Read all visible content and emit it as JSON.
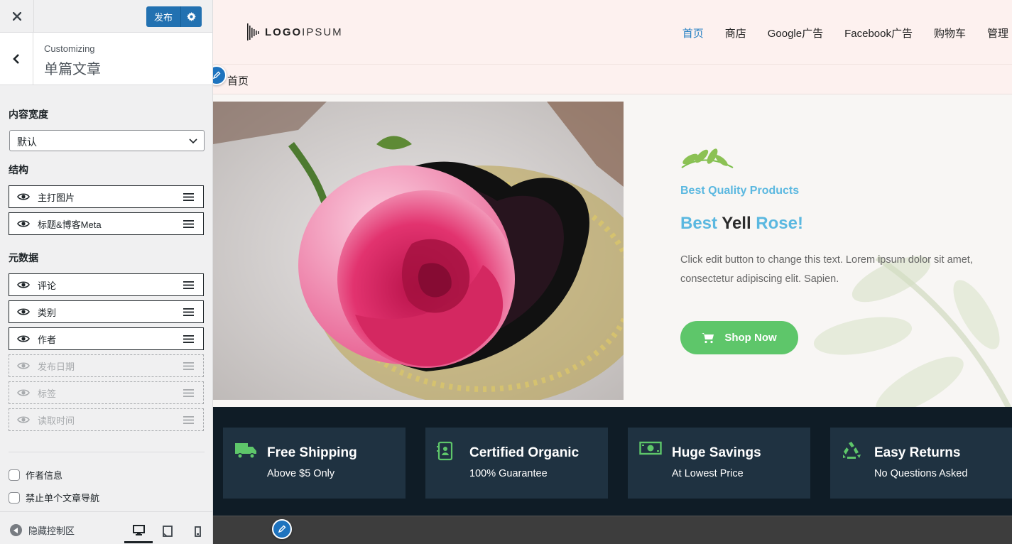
{
  "customizer": {
    "close_glyph": "✕",
    "publish_label": "发布",
    "breadcrumb_small": "Customizing",
    "section_title": "单篇文章",
    "content_width": {
      "label": "内容宽度",
      "value": "默认"
    },
    "structure": {
      "label": "结构",
      "items": [
        {
          "label": "主打图片",
          "visible": true
        },
        {
          "label": "标题&博客Meta",
          "visible": true
        }
      ]
    },
    "metadata": {
      "label": "元数据",
      "items": [
        {
          "label": "评论",
          "visible": true
        },
        {
          "label": "类别",
          "visible": true
        },
        {
          "label": "作者",
          "visible": true
        },
        {
          "label": "发布日期",
          "visible": false
        },
        {
          "label": "标签",
          "visible": false
        },
        {
          "label": "读取时间",
          "visible": false
        }
      ]
    },
    "checkboxes": [
      {
        "label": "作者信息",
        "checked": false
      },
      {
        "label": "禁止单个文章导航",
        "checked": false
      }
    ],
    "footer": {
      "hide_controls": "隐藏控制区",
      "devices": [
        "desktop",
        "tablet",
        "mobile"
      ],
      "active_device": "desktop"
    }
  },
  "site": {
    "logo": {
      "bold": "LOGO",
      "light": "IPSUM"
    },
    "nav": [
      "首页",
      "商店",
      "Google广告",
      "Facebook广告",
      "购物车",
      "管理"
    ],
    "nav_current": "首页",
    "breadcrumb": "首页",
    "hero": {
      "eyebrow": "Best Quality Products",
      "headline_part1": "Best ",
      "headline_part2": "Yell",
      "headline_part3": " Rose!",
      "text": "Click edit button to change this text. Lorem ipsum dolor sit amet, consectetur adipiscing elit. Sapien.",
      "button": "Shop Now"
    },
    "features": [
      {
        "icon": "truck-icon",
        "title": "Free Shipping",
        "subtitle": "Above $5 Only"
      },
      {
        "icon": "certificate-icon",
        "title": "Certified Organic",
        "subtitle": "100% Guarantee"
      },
      {
        "icon": "money-icon",
        "title": "Huge Savings",
        "subtitle": "At Lowest Price"
      },
      {
        "icon": "recycle-icon",
        "title": "Easy Returns",
        "subtitle": "No Questions Asked"
      }
    ]
  },
  "colors": {
    "wp_blue": "#2271b1",
    "accent_blue": "#5bb8e0",
    "green": "#5ec66a",
    "nav_current": "#2580c3",
    "header_bg": "#fdf1ef",
    "features_bg": "#0f1c26",
    "feature_card": "#1f3241"
  }
}
